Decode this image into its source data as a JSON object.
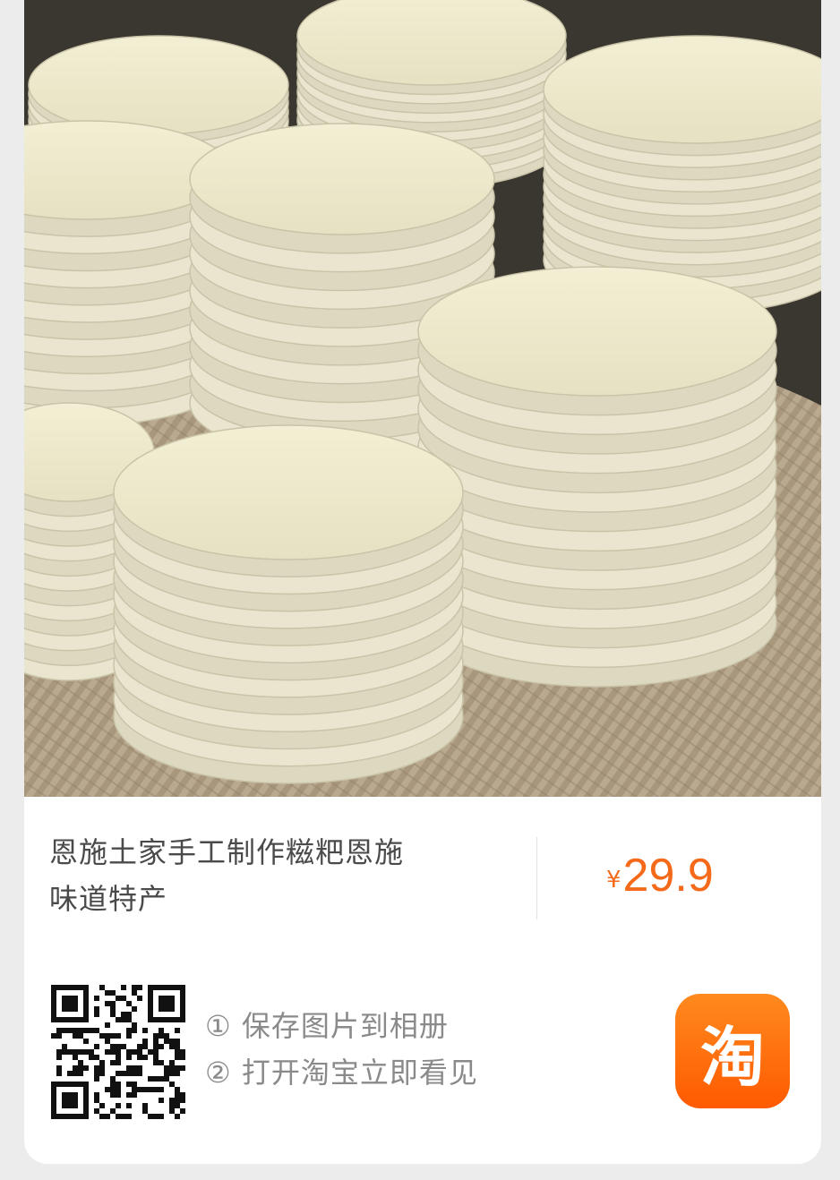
{
  "product": {
    "title_line1": "恩施土家手工制作糍粑恩施",
    "title_line2": "味道特产",
    "price_currency": "¥",
    "price_value": "29.9",
    "accent_color": "#f46a1a"
  },
  "instructions": {
    "step1": "① 保存图片到相册",
    "step2": "② 打开淘宝立即看见"
  },
  "app_logo": {
    "glyph": "淘",
    "icon": "taobao-app-icon",
    "color": "#ff6a00"
  },
  "qr_code": {
    "icon": "qr-code-icon"
  },
  "photo": {
    "icon": "product-photo"
  }
}
